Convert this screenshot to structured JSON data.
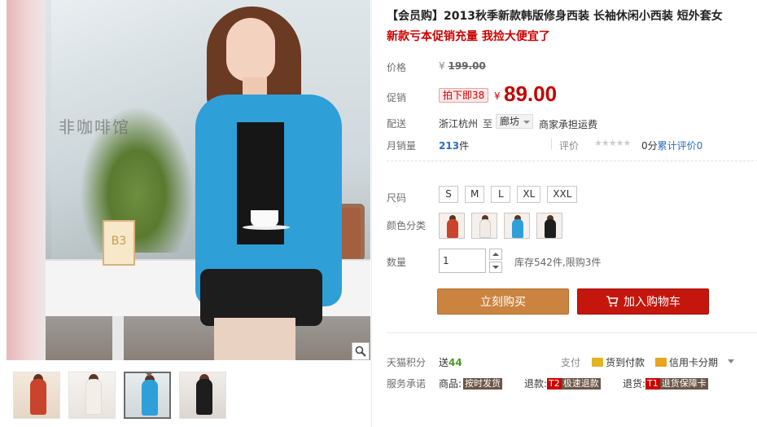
{
  "product": {
    "title": "【会员购】2013秋季新款韩版修身西装 长袖休闲小西装 短外套女",
    "subtitle": "新款亏本促销充量 我捡大便宜了"
  },
  "photo": {
    "text": "非咖啡馆",
    "sign": "B3"
  },
  "price": {
    "label": "价格",
    "currency": "¥",
    "original": "199.00"
  },
  "promo": {
    "label": "促销",
    "tag": "拍下即38",
    "currency": "¥",
    "price": "89.00"
  },
  "shipping": {
    "label": "配送",
    "from": "浙江杭州",
    "to_word": "至",
    "destination": "廊坊",
    "note": "商家承担运费"
  },
  "sales": {
    "label": "月销量",
    "count": "213",
    "unit": "件",
    "rating_label": "评价",
    "stars": "★★★★★",
    "score": "0分",
    "review_link": "累计评价0"
  },
  "size": {
    "label": "尺码",
    "options": [
      "S",
      "M",
      "L",
      "XL",
      "XXL"
    ]
  },
  "color": {
    "label": "颜色分类",
    "swatches": [
      "#c9442a",
      "#f2ece6",
      "#2f9fd8",
      "#1d1d1d"
    ]
  },
  "quantity": {
    "label": "数量",
    "value": "1",
    "stock": "库存542件,限购3件"
  },
  "buttons": {
    "buy_now": "立刻购买",
    "add_to_cart": "加入购物车"
  },
  "tmall_points": {
    "label": "天猫积分",
    "prefix": "送",
    "value": "44"
  },
  "payment": {
    "label": "支付",
    "cod": "货到付款",
    "card": "信用卡分期"
  },
  "service": {
    "label": "服务承诺",
    "goods_label": "商品:",
    "goods_tag": "按时发货",
    "refund_label": "退款:",
    "refund_code": "T2",
    "refund_tag": "极速退款",
    "return_label": "退货:",
    "return_code": "T1",
    "return_tag": "退货保障卡"
  },
  "colors": {
    "price_red": "#c40000",
    "buy_orange": "#cb843f",
    "cart_red": "#c5160d",
    "link_blue": "#2a6ebb"
  }
}
